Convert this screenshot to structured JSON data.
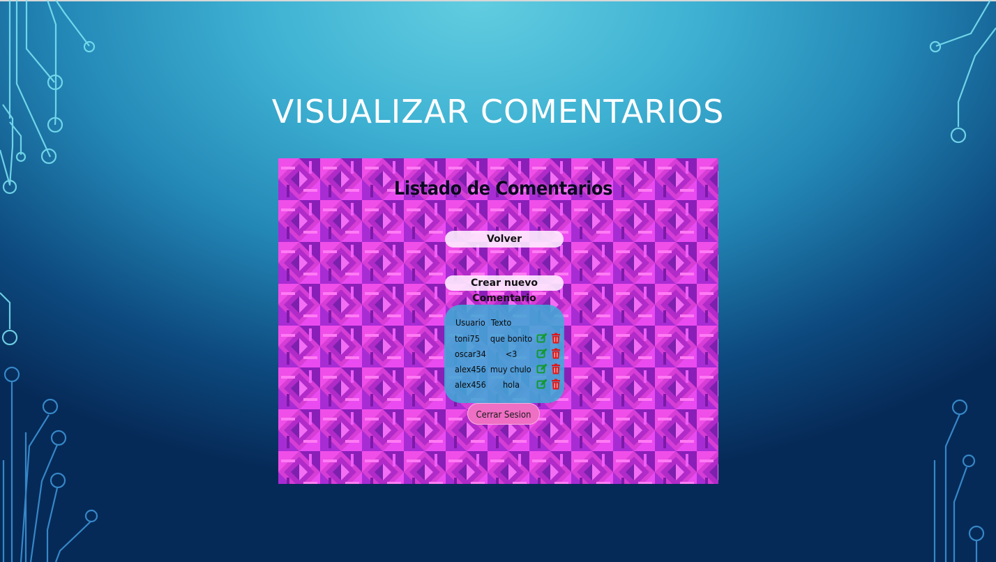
{
  "slide": {
    "title": "VISUALIZAR COMENTARIOS"
  },
  "app": {
    "heading": "Listado de Comentarios",
    "volver_label": "Volver",
    "crear_label": "Crear nuevo Comentario",
    "cerrar_label": "Cerrar Sesion",
    "table": {
      "headers": [
        "Usuario",
        "Texto"
      ],
      "rows": [
        {
          "usuario": "toni75",
          "texto": "que bonito"
        },
        {
          "usuario": "oscar34",
          "texto": "<3"
        },
        {
          "usuario": "alex456",
          "texto": "muy chulo"
        },
        {
          "usuario": "alex456",
          "texto": "hola"
        }
      ],
      "edit_icon": "edit-icon",
      "delete_icon": "trash-icon"
    }
  },
  "colors": {
    "edit": "#119a2a",
    "delete": "#e01616",
    "panel": "#40a8d6",
    "cerrar": "#ee6fc4"
  }
}
